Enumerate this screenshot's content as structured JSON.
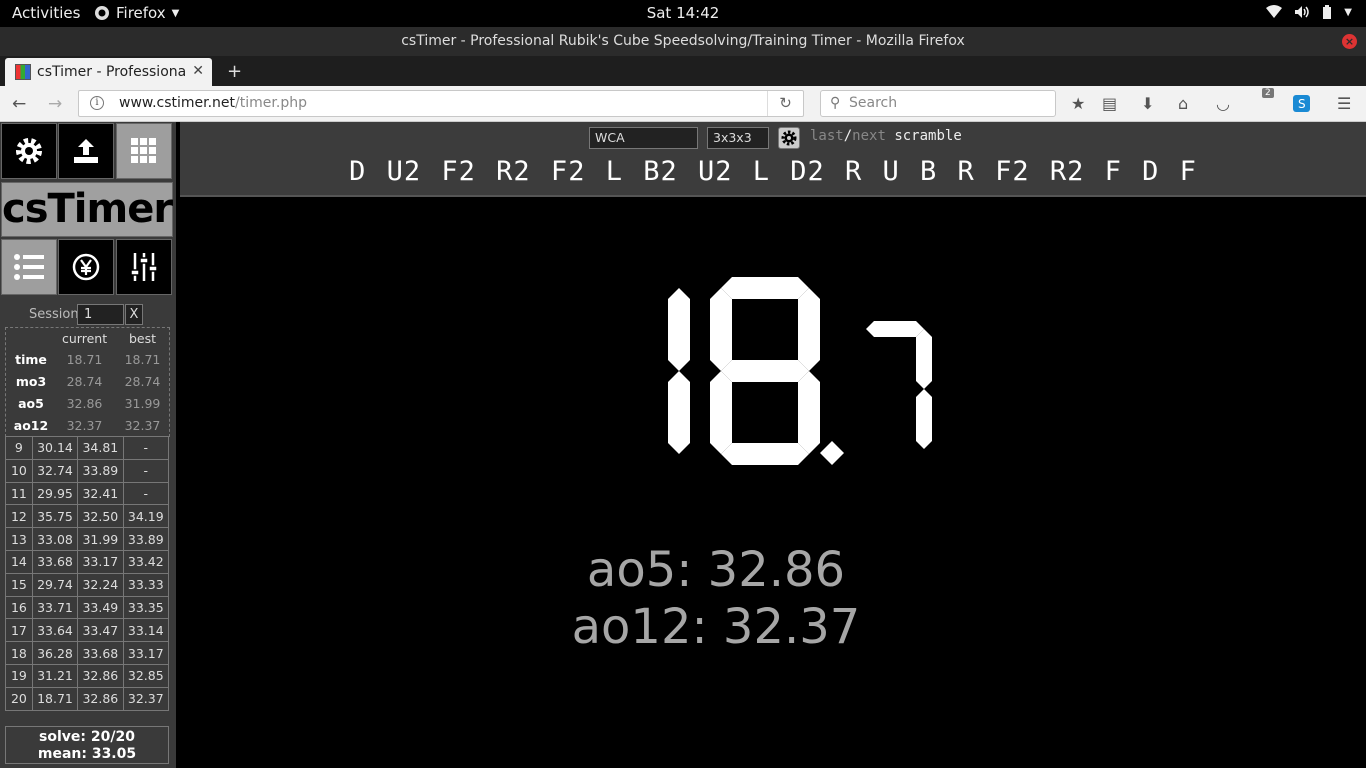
{
  "system_bar": {
    "activities": "Activities",
    "app_name": "Firefox",
    "clock": "Sat 14:42"
  },
  "window": {
    "title": "csTimer - Professional Rubik's Cube Speedsolving/Training Timer - Mozilla Firefox"
  },
  "browser": {
    "tab_title": "csTimer - Professional Rubik's Cube Speedsolving/Training Timer",
    "url_domain": "www.cstimer.net",
    "url_path": "/timer.php",
    "search_placeholder": "Search",
    "ublock_badge": "2"
  },
  "cstimer": {
    "logo": "csTimer",
    "session_label": "Session",
    "session_value": "1",
    "session_delete": "X",
    "stats": {
      "header_current": "current",
      "header_best": "best",
      "rows": [
        {
          "label": "time",
          "current": "18.71",
          "best": "18.71"
        },
        {
          "label": "mo3",
          "current": "28.74",
          "best": "28.74"
        },
        {
          "label": "ao5",
          "current": "32.86",
          "best": "31.99"
        },
        {
          "label": "ao12",
          "current": "32.37",
          "best": "32.37"
        }
      ]
    },
    "solves": [
      [
        "9",
        "30.14",
        "34.81",
        "-"
      ],
      [
        "10",
        "32.74",
        "33.89",
        "-"
      ],
      [
        "11",
        "29.95",
        "32.41",
        "-"
      ],
      [
        "12",
        "35.75",
        "32.50",
        "34.19"
      ],
      [
        "13",
        "33.08",
        "31.99",
        "33.89"
      ],
      [
        "14",
        "33.68",
        "33.17",
        "33.42"
      ],
      [
        "15",
        "29.74",
        "32.24",
        "33.33"
      ],
      [
        "16",
        "33.71",
        "33.49",
        "33.35"
      ],
      [
        "17",
        "33.64",
        "33.47",
        "33.14"
      ],
      [
        "18",
        "36.28",
        "33.68",
        "33.17"
      ],
      [
        "19",
        "31.21",
        "32.86",
        "32.85"
      ],
      [
        "20",
        "18.71",
        "32.86",
        "32.37"
      ]
    ],
    "summary_solve": "solve: 20/20",
    "summary_mean": "mean: 33.05",
    "scramble_type": "WCA",
    "puzzle": "3x3x3",
    "nav_last": "last",
    "nav_sep": "/",
    "nav_next": "next",
    "nav_scramble": "scramble",
    "scramble": "D U2 F2 R2 F2 L B2 U2 L D2 R U B R F2 R2 F D F",
    "timer_display": "18.71",
    "avg_ao5": "ao5: 32.86",
    "avg_ao12": "ao12: 32.37"
  }
}
